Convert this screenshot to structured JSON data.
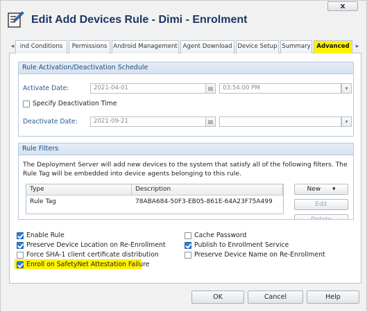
{
  "window": {
    "title": "Edit Add Devices Rule - Dimi - Enrolment",
    "close_label": "x",
    "icon": "edit-document-icon"
  },
  "tabs": {
    "scroll_left": "◂",
    "scroll_right": "▸",
    "items": [
      {
        "label": "ind Conditions"
      },
      {
        "label": "Permissions"
      },
      {
        "label": "Android Management"
      },
      {
        "label": "Agent Download"
      },
      {
        "label": "Device Setup"
      },
      {
        "label": "Summary"
      },
      {
        "label": "Advanced",
        "active": true
      }
    ]
  },
  "schedule": {
    "header": "Rule Activation/Deactivation Schedule",
    "activate_label": "Activate Date:",
    "activate_date": "2021-04-01",
    "activate_time": "03:54:00 PM",
    "specify_deactivation_label": "Specify Deactivation Time",
    "specify_deactivation_checked": false,
    "deactivate_label": "Deactivate Date:",
    "deactivate_date": "2021-09-21",
    "deactivate_time": ""
  },
  "filters": {
    "header": "Rule Filters",
    "description": "The Deployment Server will add new devices to the system that satisfy all of the following filters. The Rule Tag will be embedded into device agents belonging to this rule.",
    "columns": [
      "Type",
      "Description"
    ],
    "rows": [
      {
        "type": "Rule Tag",
        "description": "78ABA684-50F3-EB05-861E-64A23F75A499"
      }
    ],
    "new_label": "New",
    "new_arrow": "▾",
    "edit_label": "Edit",
    "delete_label": "Delete"
  },
  "options": {
    "enable_rule": {
      "label": "Enable Rule",
      "checked": true
    },
    "preserve_location": {
      "label": "Preserve Device Location on Re-Enrollment",
      "checked": true
    },
    "force_sha1": {
      "label": "Force SHA-1 client certificate distribution",
      "checked": false
    },
    "enroll_safetynet": {
      "label": "Enroll on SafetyNet Attestation Failure",
      "checked": true
    },
    "cache_password": {
      "label": "Cache Password",
      "checked": false
    },
    "publish_enrollment": {
      "label": "Publish to Enrollment Service",
      "checked": true
    },
    "preserve_name": {
      "label": "Preserve Device Name on Re-Enrollment",
      "checked": false
    }
  },
  "footer": {
    "ok_label": "OK",
    "cancel_label": "Cancel",
    "help_label": "Help"
  },
  "colors": {
    "highlight": "#fff200",
    "title": "#1b3663",
    "group_header": "#1b4c86",
    "checkbox": "#2b7cd3"
  }
}
